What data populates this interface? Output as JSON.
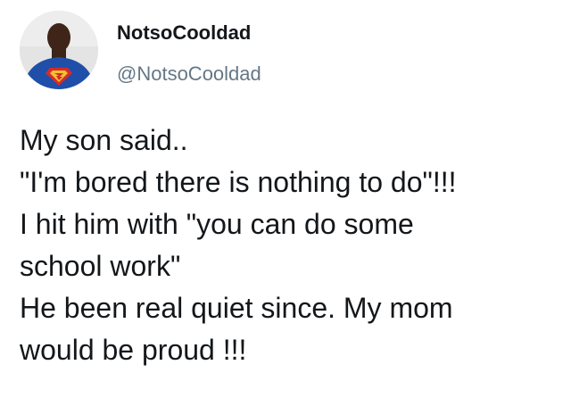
{
  "author": {
    "display_name": "NotsoCooldad",
    "handle": "@NotsoCooldad",
    "avatar_icon": "user-avatar-superman-shirt"
  },
  "tweet": {
    "lines": [
      "My son said..",
      "\"I'm bored there is nothing to do\"!!!",
      "I hit him with \"you can do some",
      "school work\"",
      "He been real quiet since. My mom",
      "would be proud !!!"
    ]
  },
  "colors": {
    "text": "#14171a",
    "handle": "#657786",
    "shirt": "#1f4fa8",
    "emblem_red": "#d62b2b",
    "emblem_yellow": "#f2c230"
  }
}
